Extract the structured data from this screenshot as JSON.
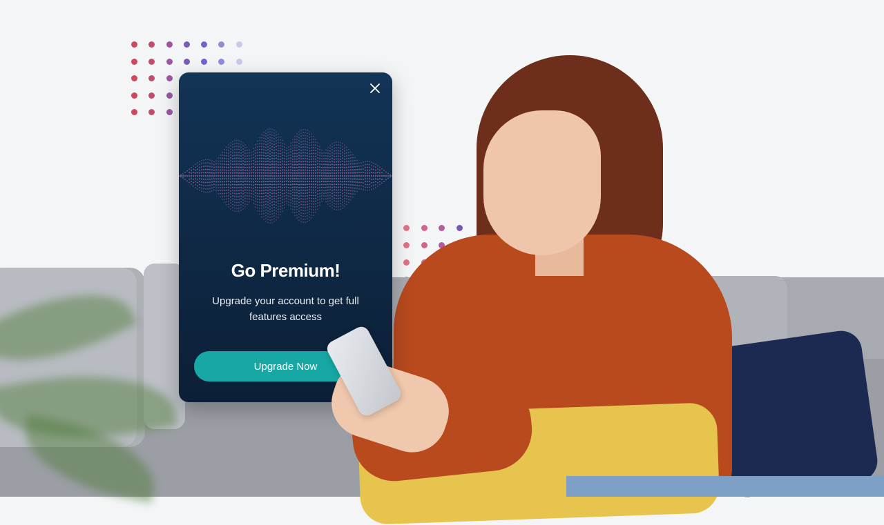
{
  "popup": {
    "title": "Go Premium!",
    "subtitle": "Upgrade your account to get full features access",
    "cta_label": "Upgrade Now",
    "close_icon": "close-icon"
  },
  "colors": {
    "popup_bg": "#0f2a47",
    "cta": "#17a7a4",
    "sweater": "#b94a1e",
    "background": "#f4f5f7"
  }
}
